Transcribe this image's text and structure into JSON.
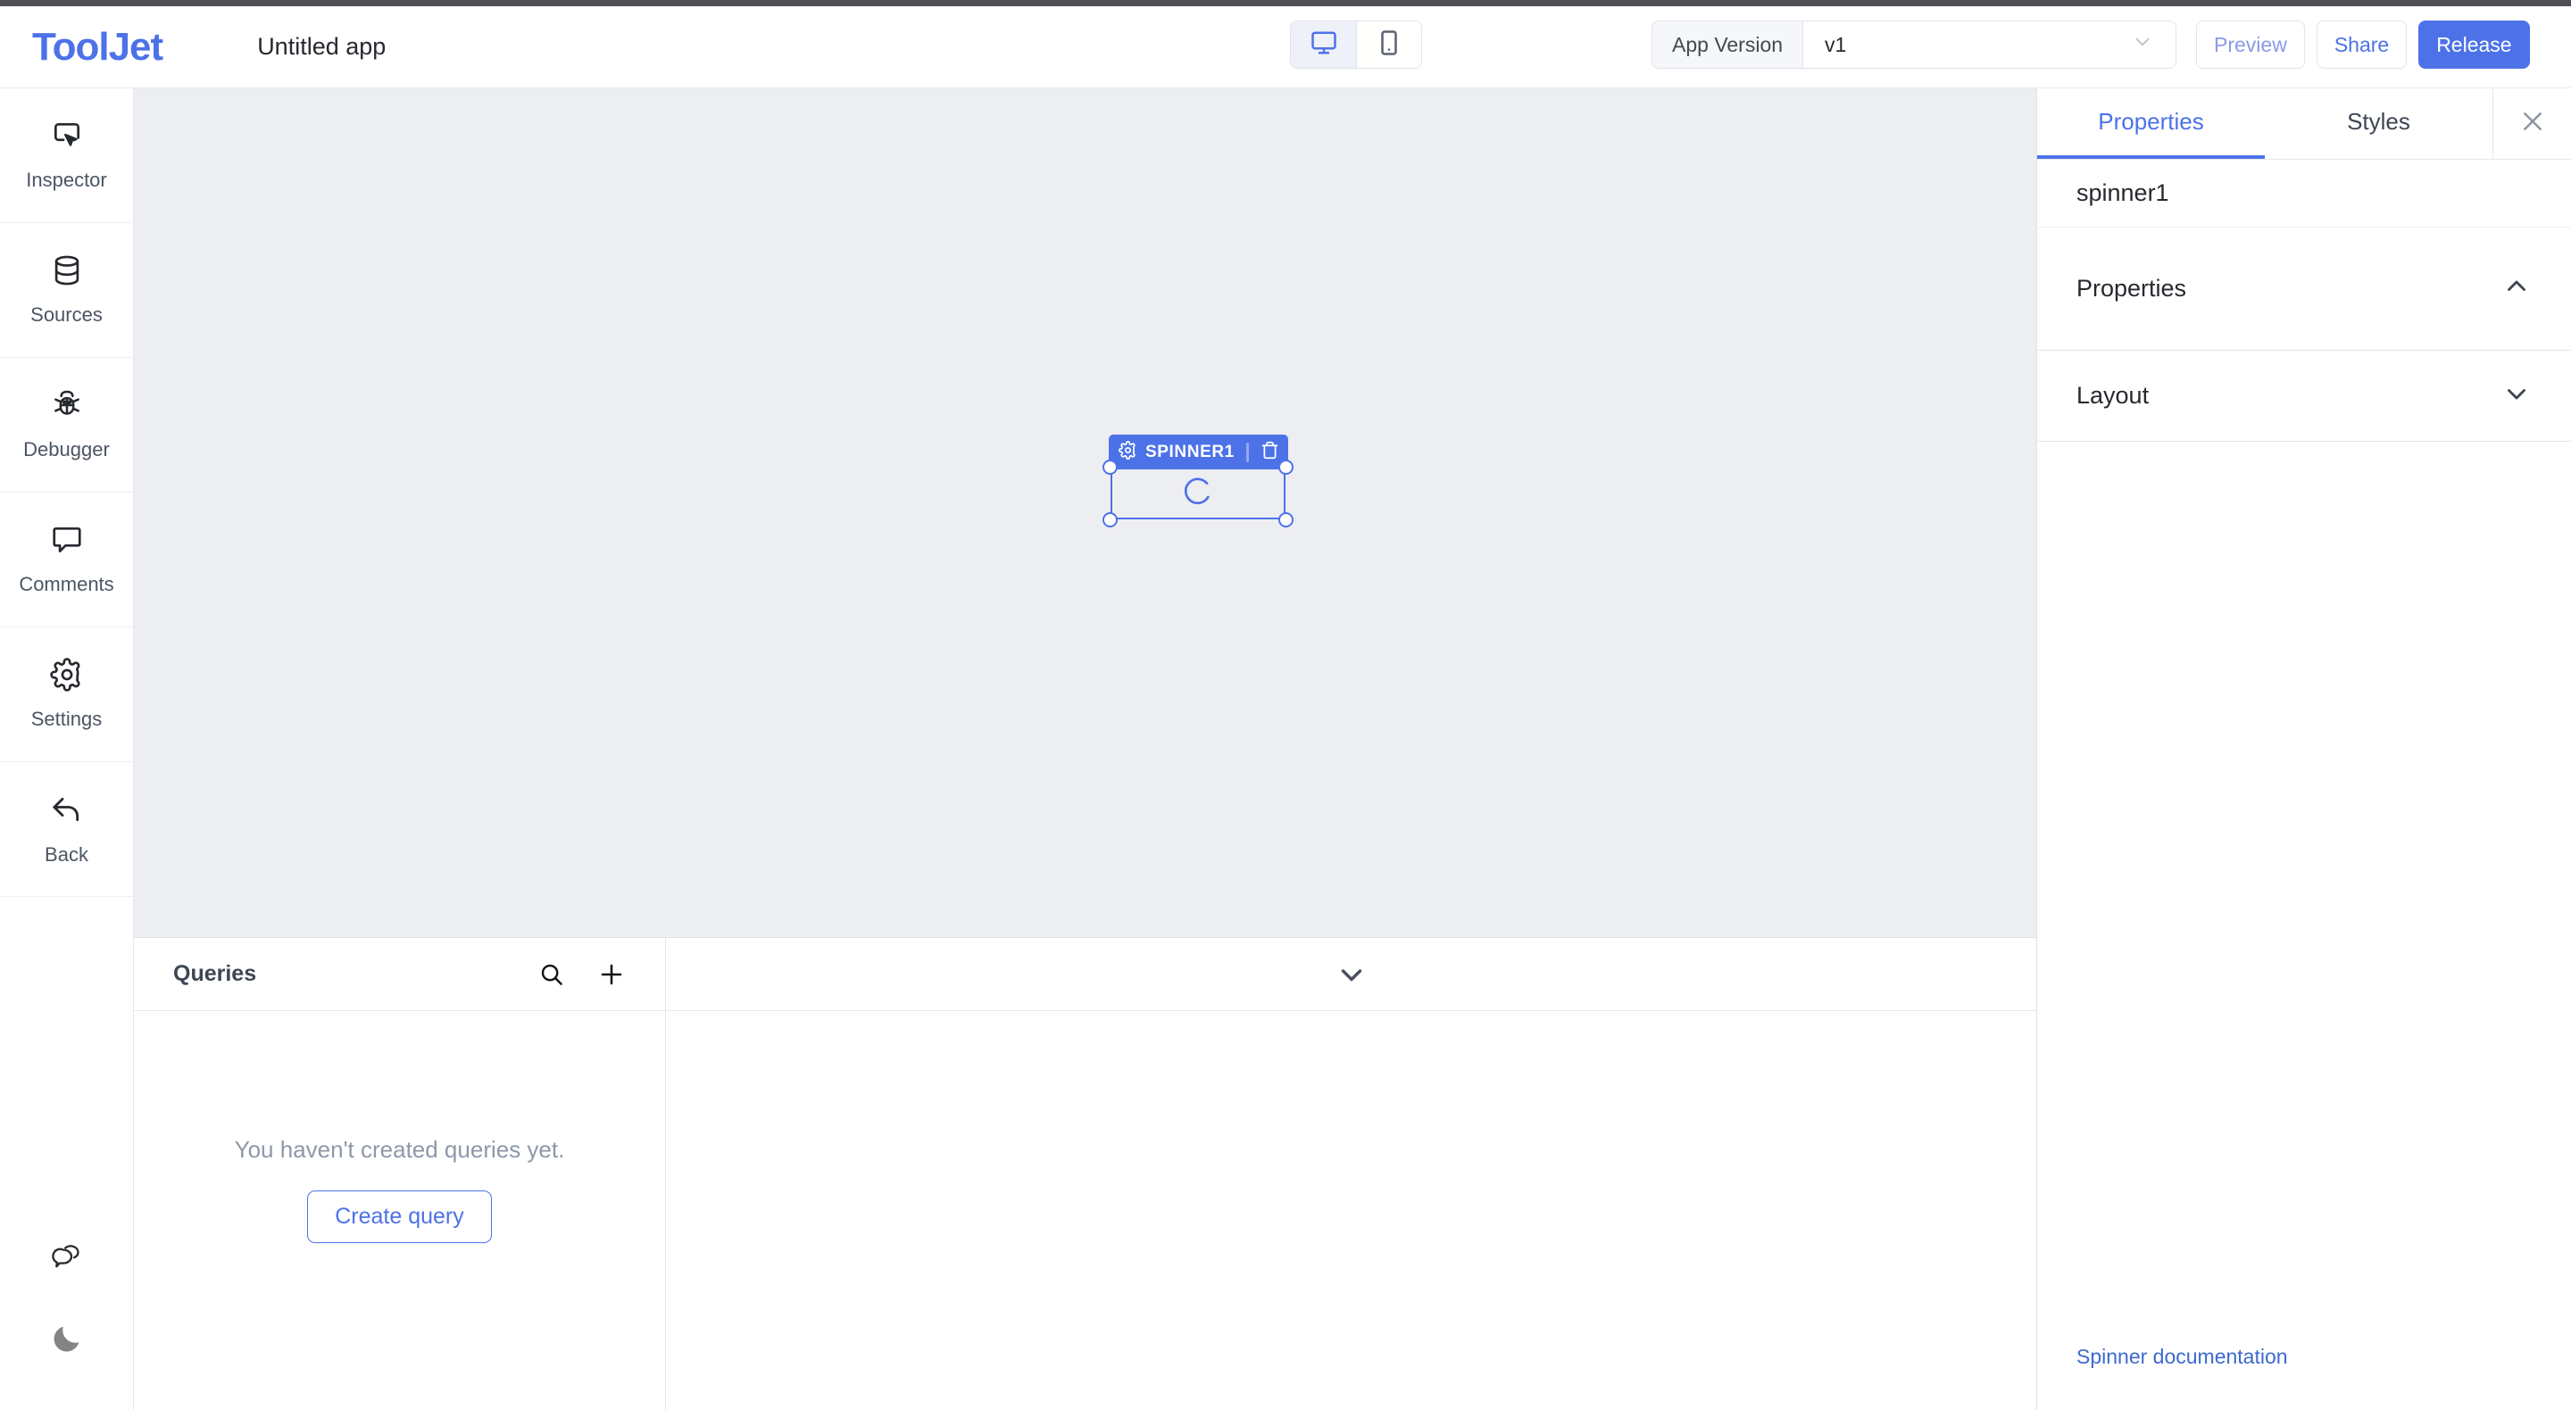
{
  "header": {
    "brand": "ToolJet",
    "app_title": "Untitled app",
    "device_toggle": {
      "desktop": {
        "name": "desktop-view",
        "active": true
      },
      "mobile": {
        "name": "mobile-view",
        "active": false
      }
    },
    "version": {
      "label": "App Version",
      "value": "v1"
    },
    "buttons": {
      "preview": "Preview",
      "share": "Share",
      "release": "Release"
    }
  },
  "sidebar": {
    "items": [
      {
        "label": "Inspector",
        "icon": "inspector-icon"
      },
      {
        "label": "Sources",
        "icon": "database-icon"
      },
      {
        "label": "Debugger",
        "icon": "bug-icon"
      },
      {
        "label": "Comments",
        "icon": "comment-icon"
      },
      {
        "label": "Settings",
        "icon": "gear-icon"
      },
      {
        "label": "Back",
        "icon": "back-arrow-icon"
      }
    ],
    "bottom": [
      {
        "icon": "chat-support-icon"
      },
      {
        "icon": "moon-icon"
      }
    ]
  },
  "canvas": {
    "widget": {
      "name": "SPINNER1",
      "type": "spinner",
      "gear_icon": "gear-icon",
      "delete_icon": "trash-icon"
    }
  },
  "queries": {
    "title": "Queries",
    "search_icon": "search-icon",
    "add_icon": "plus-icon",
    "empty_text": "You haven't created queries yet.",
    "create_button": "Create query",
    "collapse_icon": "chevron-down-icon"
  },
  "right_panel": {
    "tabs": [
      {
        "label": "Properties",
        "active": true
      },
      {
        "label": "Styles",
        "active": false
      }
    ],
    "close_icon": "close-icon",
    "component_name": "spinner1",
    "sections": [
      {
        "label": "Properties",
        "expanded": true,
        "chevron": "chevron-up-icon"
      },
      {
        "label": "Layout",
        "expanded": false,
        "chevron": "chevron-down-icon"
      }
    ],
    "doc_link": "Spinner documentation"
  },
  "colors": {
    "accent": "#4d72e8",
    "canvas_bg": "#edeef2",
    "text": "#26292e",
    "muted": "#8e98a8",
    "top_strip": "#4f5055"
  }
}
